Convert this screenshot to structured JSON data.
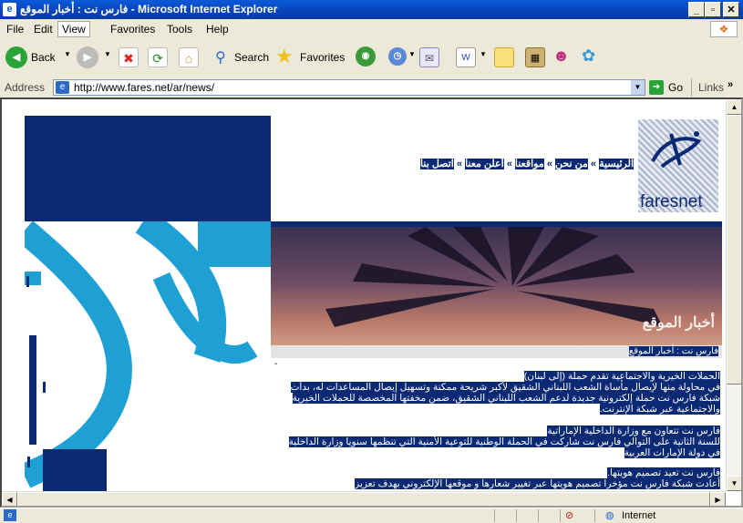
{
  "window": {
    "title": "فارس نت : أخبار الموقع - Microsoft Internet Explorer",
    "minimize": "_",
    "maximize": "▫",
    "close": "✕"
  },
  "menu": [
    "File",
    "Edit",
    "View",
    "Favorites",
    "Tools",
    "Help"
  ],
  "toolbar": {
    "back": "Back",
    "search": "Search",
    "favorites": "Favorites"
  },
  "address": {
    "label": "Address",
    "url": "http://www.fares.net/ar/news/",
    "go": "Go",
    "links": "Links"
  },
  "site": {
    "logo_text": "faresnet",
    "nav": [
      "الرئيسية",
      "من نحن",
      "مواقعنا",
      "أعلن معنا",
      "اتصل بنا"
    ],
    "nav_sep": "»",
    "banner_title": "أخبار الموقع",
    "breadcrumb": "فارس نت : أخبار الموقع",
    "dash": "-",
    "articles": [
      {
        "title": "الحملات الخيرية والاجتماعية تقدم حملة (إلى لبنان)",
        "body": "في محاولة منها لإيصال مأساة الشعب اللبناني الشقيق لأكبر شريحة ممكنة وتسهيل إيصال المساعدات له، بدأت شبكة فارس نت حملة إلكترونية جديدة لدعم الشعب اللبناني الشقيق، ضمن مخفتها المخصصة للحملات الخيرية والاجتماعية عبر شبكة الإنترنت."
      },
      {
        "title": "فارس نت تتعاون مع وزارة الداخلية الإماراتية",
        "body": "للسنة الثانية على التوالي فارس نت شاركت في الحملة الوطنية للتوعية الأمنية التي تنظمها سنويا وزارة الداخلية في دولة الإمارات العربية"
      },
      {
        "title": "فارس نت تعيد تصميم هويتها.",
        "body": "أعادت شبكة فارس نت مؤخرا تصميم هويتها عبر تغيير شعارها و موقعها الإلكتروني بهدف تعزيز"
      }
    ]
  },
  "status": {
    "zone": "Internet"
  },
  "colors": {
    "navy": "#0b2a73",
    "cyan": "#1fa0d4",
    "titlebar": "#0a5ad8"
  }
}
